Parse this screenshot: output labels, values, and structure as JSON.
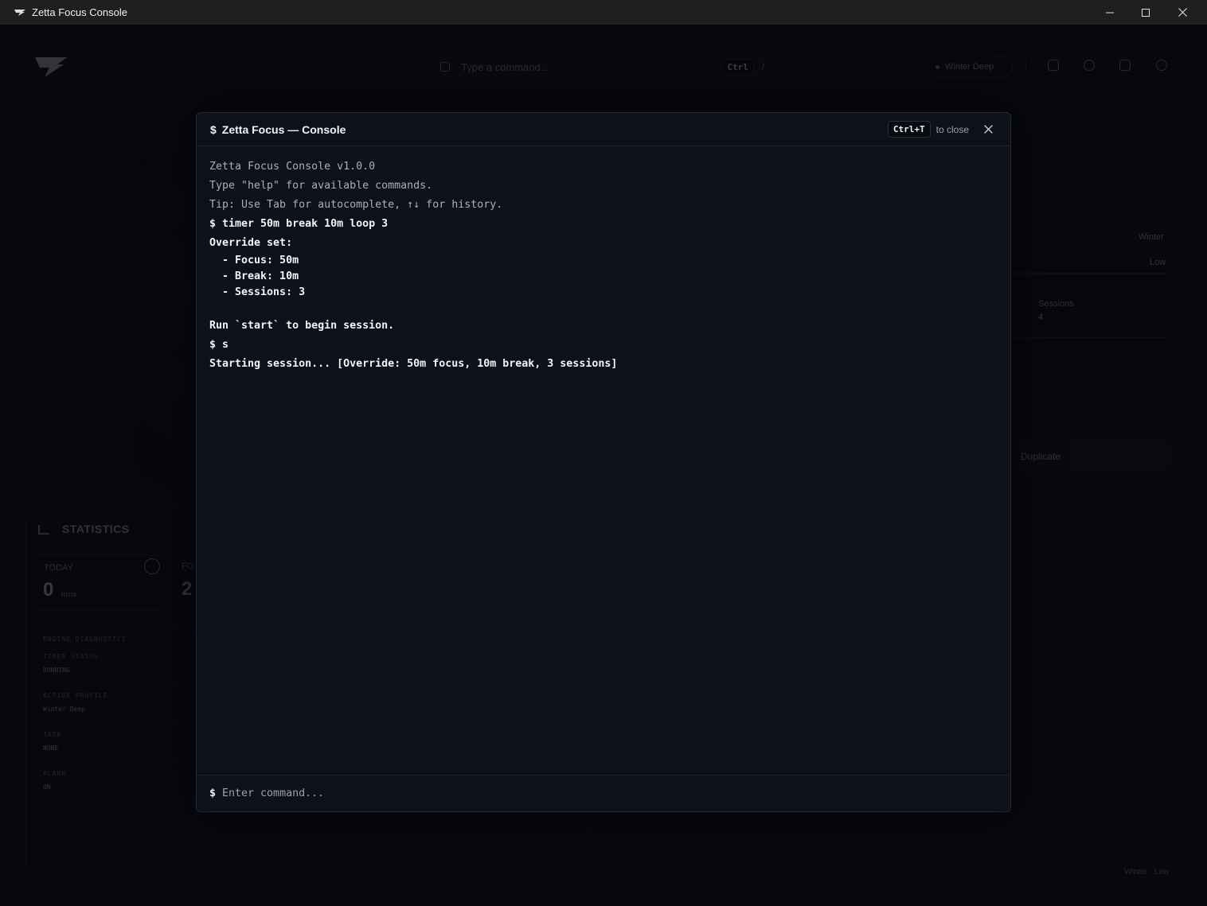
{
  "window": {
    "title": "Zetta Focus Console"
  },
  "background": {
    "command_placeholder": "Type a command...",
    "command_kbd": "Ctrl",
    "command_kbd2": "/",
    "profile_chip": "Winter Deep",
    "side_winter": "Winter",
    "side_low": "Low",
    "side_sessions_label": "Sessions",
    "side_sessions_value": "4",
    "duplicate_label": "Duplicate",
    "stats_title": "STATISTICS",
    "today_label": "TODAY",
    "today_value": "0",
    "today_unit": "mins",
    "fo_label": "FO",
    "fo_value": "2",
    "diagnostics_title": "ENGINE DIAGNOSTICS",
    "diag": [
      {
        "label": "TIMER STATUS",
        "value": "RUNNING"
      },
      {
        "label": "ACTIVE PROFILE",
        "value": "Winter Deep"
      },
      {
        "label": "TASK",
        "value": "NONE"
      },
      {
        "label": "ALARM",
        "value": "ON"
      }
    ],
    "footer": "Winter · Low"
  },
  "console": {
    "title": "Zetta Focus — Console",
    "title_prefix": "$",
    "shortcut_key": "Ctrl+T",
    "shortcut_text": "to close",
    "lines": {
      "l1": "Zetta Focus Console v1.0.0",
      "l2": "Type \"help\" for available commands.",
      "l3": "Tip: Use Tab for autocomplete, ↑↓ for history.",
      "l4": "$ timer 50m break 10m loop 3",
      "l5": "Override set:",
      "l6": "  - Focus: 50m",
      "l7": "  - Break: 10m",
      "l8": "  - Sessions: 3",
      "l9": "Run `start` to begin session.",
      "l10": "$ s",
      "l11": "Starting session... [Override: 50m focus, 10m break, 3 sessions]"
    },
    "prompt": "$",
    "input_placeholder": "Enter command...",
    "input_value": ""
  },
  "colors": {
    "background": "#06070b",
    "modal": "#0e101a",
    "text": "#f2f4f8",
    "muted": "#a9afbd"
  }
}
